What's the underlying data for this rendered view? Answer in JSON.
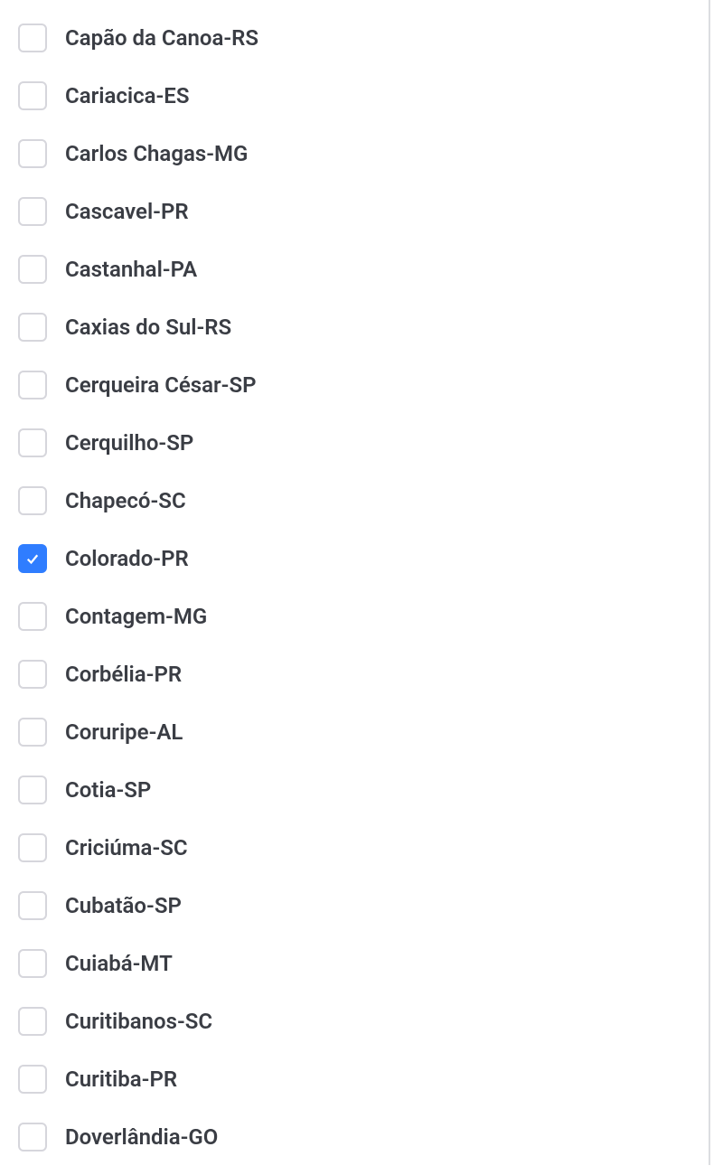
{
  "items": [
    {
      "label": "Capão da Canoa-RS",
      "checked": false
    },
    {
      "label": "Cariacica-ES",
      "checked": false
    },
    {
      "label": "Carlos Chagas-MG",
      "checked": false
    },
    {
      "label": "Cascavel-PR",
      "checked": false
    },
    {
      "label": "Castanhal-PA",
      "checked": false
    },
    {
      "label": "Caxias do Sul-RS",
      "checked": false
    },
    {
      "label": "Cerqueira César-SP",
      "checked": false
    },
    {
      "label": "Cerquilho-SP",
      "checked": false
    },
    {
      "label": "Chapecó-SC",
      "checked": false
    },
    {
      "label": "Colorado-PR",
      "checked": true
    },
    {
      "label": "Contagem-MG",
      "checked": false
    },
    {
      "label": "Corbélia-PR",
      "checked": false
    },
    {
      "label": "Coruripe-AL",
      "checked": false
    },
    {
      "label": "Cotia-SP",
      "checked": false
    },
    {
      "label": "Criciúma-SC",
      "checked": false
    },
    {
      "label": "Cubatão-SP",
      "checked": false
    },
    {
      "label": "Cuiabá-MT",
      "checked": false
    },
    {
      "label": "Curitibanos-SC",
      "checked": false
    },
    {
      "label": "Curitiba-PR",
      "checked": false
    },
    {
      "label": "Doverlândia-GO",
      "checked": false
    }
  ]
}
